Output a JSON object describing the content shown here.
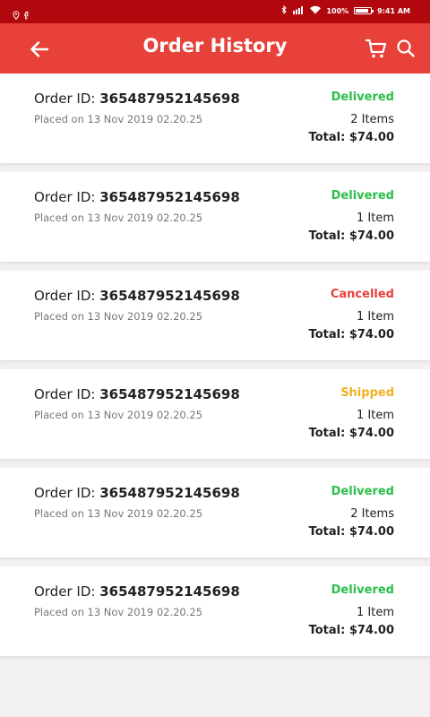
{
  "status_bar": {
    "battery": "100%",
    "battery_level": 0.85,
    "time": "9:41 AM"
  },
  "app_bar": {
    "title": "Order History"
  },
  "order_id_label": "Order ID: ",
  "colors": {
    "Delivered": "#2bbf4a",
    "Cancelled": "#e8413a",
    "Shipped": "#f0b121",
    "app_bar": "#e8413a",
    "status_bar": "#b0080d"
  },
  "orders": [
    {
      "id": "365487952145698",
      "placed": "Placed on 13 Nov 2019 02.20.25",
      "status": "Delivered",
      "items": "2 Items",
      "total": "Total: $74.00"
    },
    {
      "id": "365487952145698",
      "placed": "Placed on 13 Nov 2019 02.20.25",
      "status": "Delivered",
      "items": "1 Item",
      "total": "Total: $74.00"
    },
    {
      "id": "365487952145698",
      "placed": "Placed on 13 Nov 2019 02.20.25",
      "status": "Cancelled",
      "items": "1 Item",
      "total": "Total: $74.00"
    },
    {
      "id": "365487952145698",
      "placed": "Placed on 13 Nov 2019 02.20.25",
      "status": "Shipped",
      "items": "1 Item",
      "total": "Total: $74.00"
    },
    {
      "id": "365487952145698",
      "placed": "Placed on 13 Nov 2019 02.20.25",
      "status": "Delivered",
      "items": "2 Items",
      "total": "Total: $74.00"
    },
    {
      "id": "365487952145698",
      "placed": "Placed on 13 Nov 2019 02.20.25",
      "status": "Delivered",
      "items": "1 Item",
      "total": "Total: $74.00"
    }
  ]
}
